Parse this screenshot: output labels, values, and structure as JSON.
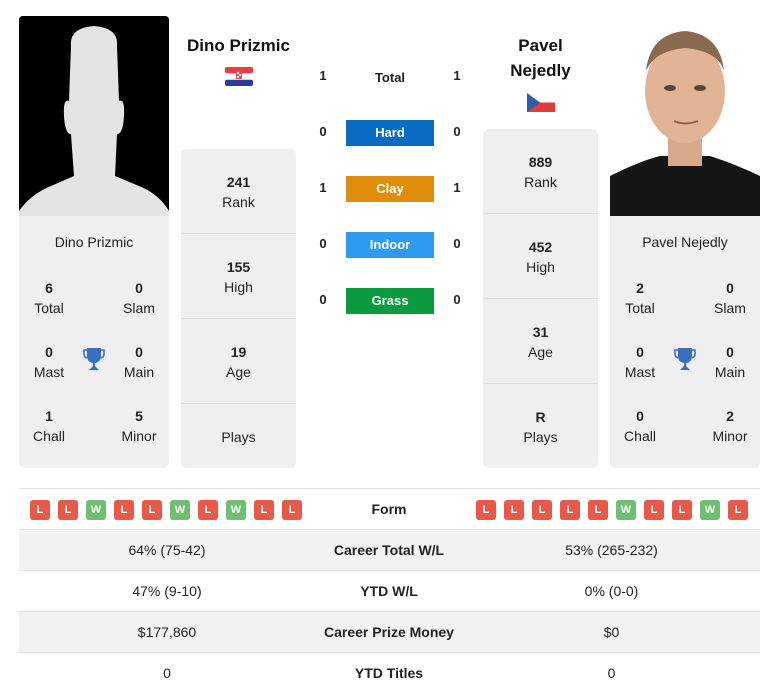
{
  "player1": {
    "name": "Dino Prizmic",
    "country_flag": "croatia-flag",
    "photo": "silhouette-placeholder",
    "titles": {
      "total": {
        "value": "6",
        "label": "Total"
      },
      "slam": {
        "value": "0",
        "label": "Slam"
      },
      "mast": {
        "value": "0",
        "label": "Mast"
      },
      "main": {
        "value": "0",
        "label": "Main"
      },
      "chall": {
        "value": "1",
        "label": "Chall"
      },
      "minor": {
        "value": "5",
        "label": "Minor"
      }
    },
    "stats": {
      "rank": {
        "value": "241",
        "label": "Rank"
      },
      "high": {
        "value": "155",
        "label": "High"
      },
      "age": {
        "value": "19",
        "label": "Age"
      },
      "plays": {
        "value": "",
        "label": "Plays"
      }
    },
    "form": [
      "L",
      "L",
      "W",
      "L",
      "L",
      "W",
      "L",
      "W",
      "L",
      "L"
    ],
    "career_total_wl": "64% (75-42)",
    "ytd_wl": "47% (9-10)",
    "career_prize_money": "$177,860",
    "ytd_titles": "0"
  },
  "player2": {
    "name": "Pavel Nejedly",
    "name_line1": "Pavel",
    "name_line2": "Nejedly",
    "country_flag": "czech-republic-flag",
    "photo": "player-headshot",
    "titles": {
      "total": {
        "value": "2",
        "label": "Total"
      },
      "slam": {
        "value": "0",
        "label": "Slam"
      },
      "mast": {
        "value": "0",
        "label": "Mast"
      },
      "main": {
        "value": "0",
        "label": "Main"
      },
      "chall": {
        "value": "0",
        "label": "Chall"
      },
      "minor": {
        "value": "2",
        "label": "Minor"
      }
    },
    "stats": {
      "rank": {
        "value": "889",
        "label": "Rank"
      },
      "high": {
        "value": "452",
        "label": "High"
      },
      "age": {
        "value": "31",
        "label": "Age"
      },
      "plays": {
        "value": "R",
        "label": "Plays"
      }
    },
    "form": [
      "L",
      "L",
      "L",
      "L",
      "L",
      "W",
      "L",
      "L",
      "W",
      "L"
    ],
    "career_total_wl": "53% (265-232)",
    "ytd_wl": "0% (0-0)",
    "career_prize_money": "$0",
    "ytd_titles": "0"
  },
  "h2h": {
    "total": {
      "label": "Total",
      "p1": "1",
      "p2": "1"
    },
    "surfaces": [
      {
        "label": "Hard",
        "p1": "0",
        "p2": "0",
        "color": "#0a6bc2"
      },
      {
        "label": "Clay",
        "p1": "1",
        "p2": "1",
        "color": "#e08d0b"
      },
      {
        "label": "Indoor",
        "p1": "0",
        "p2": "0",
        "color": "#2e9bf0"
      },
      {
        "label": "Grass",
        "p1": "0",
        "p2": "0",
        "color": "#0b9a3d"
      }
    ]
  },
  "table": {
    "form_label": "Form",
    "career_total_label": "Career Total W/L",
    "ytd_wl_label": "YTD W/L",
    "prize_label": "Career Prize Money",
    "ytd_titles_label": "YTD Titles"
  },
  "colors": {
    "loss": "#e8594a",
    "win": "#6fbf73",
    "trophy": "#3a6fc0",
    "card_bg": "#efefef"
  }
}
